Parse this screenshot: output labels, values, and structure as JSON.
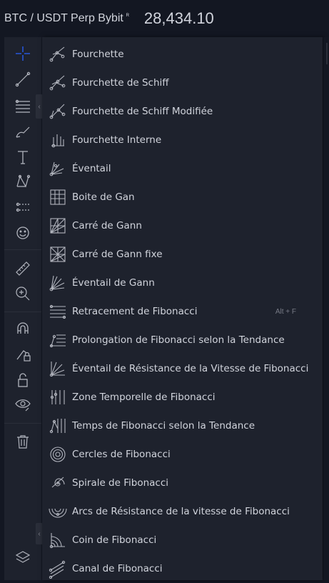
{
  "header": {
    "symbol": "BTC / USDT Perp Bybit",
    "symbol_flag": "ᴿ",
    "price": "28,434.10"
  },
  "toolbar": {
    "tools": [
      "crosshair-icon",
      "trend-line-icon",
      "fib-tools-icon",
      "brush-icon",
      "text-icon",
      "pattern-icon",
      "forecast-icon",
      "emoji-icon",
      "ruler-icon",
      "zoom-in-icon",
      "magnet-icon",
      "lock-drawings-icon",
      "unlock-icon",
      "eye-icon",
      "trash-icon",
      "layers-icon"
    ],
    "accent": "#2962ff"
  },
  "menu": {
    "items": [
      {
        "label": "Fourchette",
        "icon": "pitchfork-icon"
      },
      {
        "label": "Fourchette de Schiff",
        "icon": "schiff-pitchfork-icon"
      },
      {
        "label": "Fourchette de Schiff Modifiée",
        "icon": "modified-schiff-icon"
      },
      {
        "label": "Fourchette Interne",
        "icon": "inside-pitchfork-icon"
      },
      {
        "label": "Éventail",
        "icon": "pitchfan-icon"
      },
      {
        "label": "Boite de Gan",
        "icon": "gann-box-icon"
      },
      {
        "label": "Carré de Gann",
        "icon": "gann-square-icon"
      },
      {
        "label": "Carré de Gann fixe",
        "icon": "gann-square-fixed-icon"
      },
      {
        "label": "Éventail de Gann",
        "icon": "gann-fan-icon"
      },
      {
        "label": "Retracement de Fibonacci",
        "icon": "fib-retracement-icon",
        "hotkey": "Alt + F"
      },
      {
        "label": "Prolongation de Fibonacci selon la Tendance",
        "icon": "fib-extension-icon"
      },
      {
        "label": "Éventail de Résistance de la Vitesse de Fibonacci",
        "icon": "fib-speed-fan-icon"
      },
      {
        "label": "Zone Temporelle de Fibonacci",
        "icon": "fib-timezone-icon"
      },
      {
        "label": "Temps de Fibonacci selon la Tendance",
        "icon": "fib-trend-time-icon"
      },
      {
        "label": "Cercles de Fibonacci",
        "icon": "fib-circles-icon"
      },
      {
        "label": "Spirale de Fibonacci",
        "icon": "fib-spiral-icon"
      },
      {
        "label": "Arcs de Résistance de la vitesse de Fibonacci",
        "icon": "fib-arcs-icon"
      },
      {
        "label": "Coin de Fibonacci",
        "icon": "fib-wedge-icon"
      },
      {
        "label": "Canal de Fibonacci",
        "icon": "fib-channel-icon"
      }
    ]
  }
}
